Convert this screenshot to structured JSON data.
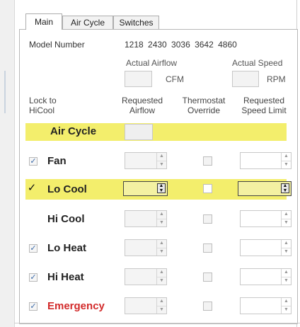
{
  "tabs": [
    {
      "label": "Main",
      "active": true
    },
    {
      "label": "Air Cycle",
      "active": false
    },
    {
      "label": "Switches",
      "active": false
    }
  ],
  "header": {
    "model_number_label": "Model Number",
    "model_numbers": "1218 2430 3036 3642 4860",
    "actual_airflow_label": "Actual Airflow",
    "actual_airflow_unit": "CFM",
    "actual_airflow_value": "",
    "actual_speed_label": "Actual Speed",
    "actual_speed_unit": "RPM",
    "actual_speed_value": ""
  },
  "columns": {
    "lock": "Lock to\nHiCool",
    "requested_airflow": "Requested\nAirflow",
    "thermostat_override": "Thermostat\nOverride",
    "requested_speed_limit": "Requested\nSpeed Limit"
  },
  "air_cycle": {
    "label": "Air Cycle",
    "value": ""
  },
  "rows": [
    {
      "label": "Fan",
      "lock": true,
      "highlight": false,
      "color": "#222222"
    },
    {
      "label": "Lo Cool",
      "lock": true,
      "highlight": true,
      "color": "#222222"
    },
    {
      "label": "Hi Cool",
      "lock": false,
      "highlight": false,
      "color": "#222222"
    },
    {
      "label": "Lo Heat",
      "lock": true,
      "highlight": false,
      "color": "#222222"
    },
    {
      "label": "Hi Heat",
      "lock": true,
      "highlight": false,
      "color": "#222222"
    },
    {
      "label": "Emergency",
      "lock": true,
      "highlight": false,
      "color": "#d22a2a"
    }
  ],
  "colors": {
    "highlight_band": "#f3ee6c",
    "emergency": "#d22a2a"
  },
  "icons": {
    "checkbox_checked": "check-icon",
    "spin_up": "up-arrow-icon",
    "spin_down": "down-arrow-icon"
  }
}
